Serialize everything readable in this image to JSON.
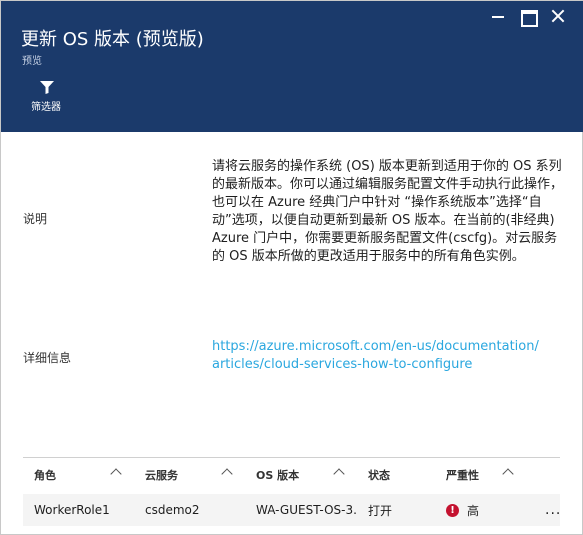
{
  "header": {
    "title": "更新 OS 版本 (预览版)",
    "subtitle": "预览",
    "filter_label": "筛选器"
  },
  "details": {
    "description_label": "说明",
    "description_text": "请将云服务的操作系统 (OS) 版本更新到适用于你的 OS 系列的最新版本。你可以通过编辑服务配置文件手动执行此操作，也可以在 Azure 经典门户中针对 “操作系统版本”选择“自动”选项，以便自动更新到最新 OS 版本。在当前的(非经典) Azure 门户中，你需要更新服务配置文件(cscfg)。对云服务的 OS 版本所做的更改适用于服务中的所有角色实例。",
    "more_info_label": "详细信息",
    "link_line1": "https://azure.microsoft.com/en-us/documentation/",
    "link_line2": "articles/cloud-services-how-to-configure"
  },
  "table": {
    "headers": [
      "角色",
      "云服务",
      "OS 版本",
      "状态",
      "严重性"
    ],
    "rows": [
      {
        "role": "WorkerRole1",
        "cloud_service": "csdemo2",
        "os_version": "WA-GUEST-OS-3...",
        "status": "打开",
        "severity": "高",
        "more": "..."
      }
    ]
  },
  "colors": {
    "header_bg": "#1b3a6b",
    "link": "#2aa7df",
    "severity_high": "#c4122f"
  },
  "icons": {
    "window": [
      "minimize-icon",
      "maximize-icon",
      "close-icon"
    ],
    "filter": "funnel-icon",
    "sort": "chevron-up-icon",
    "severity": "error-circle-icon"
  }
}
